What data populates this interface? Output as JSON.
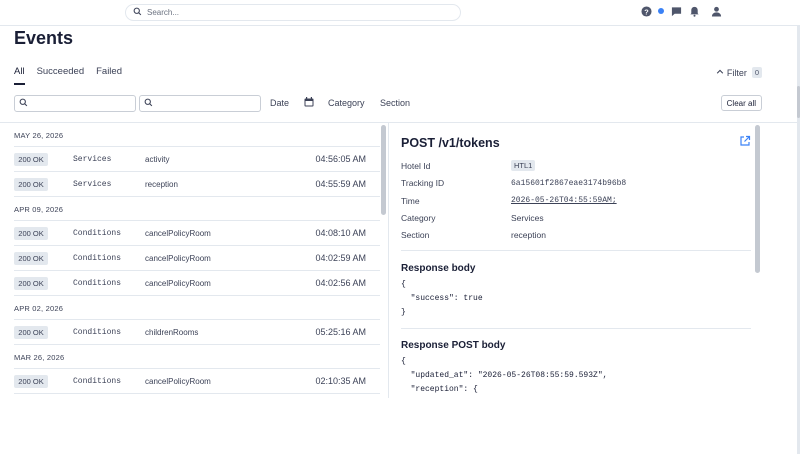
{
  "search": {
    "placeholder": "Search..."
  },
  "page": {
    "title": "Events"
  },
  "tabs": [
    {
      "label": "All",
      "active": true
    },
    {
      "label": "Succeeded",
      "active": false
    },
    {
      "label": "Failed",
      "active": false
    }
  ],
  "filter": {
    "label": "Filter",
    "count": "0"
  },
  "filter_bar": {
    "date_label": "Date",
    "category_label": "Category",
    "section_label": "Section",
    "clear_label": "Clear all"
  },
  "groups": [
    {
      "date": "MAY 26, 2026",
      "rows": [
        {
          "status": "200 OK",
          "category": "Services",
          "section": "activity",
          "time": "04:56:05 AM"
        },
        {
          "status": "200 OK",
          "category": "Services",
          "section": "reception",
          "time": "04:55:59 AM"
        }
      ]
    },
    {
      "date": "APR 09, 2026",
      "rows": [
        {
          "status": "200 OK",
          "category": "Conditions",
          "section": "cancelPolicyRoom",
          "time": "04:08:10 AM"
        },
        {
          "status": "200 OK",
          "category": "Conditions",
          "section": "cancelPolicyRoom",
          "time": "04:02:59 AM"
        },
        {
          "status": "200 OK",
          "category": "Conditions",
          "section": "cancelPolicyRoom",
          "time": "04:02:56 AM"
        }
      ]
    },
    {
      "date": "APR 02, 2026",
      "rows": [
        {
          "status": "200 OK",
          "category": "Conditions",
          "section": "childrenRooms",
          "time": "05:25:16 AM"
        }
      ]
    },
    {
      "date": "MAR 26, 2026",
      "rows": [
        {
          "status": "200 OK",
          "category": "Conditions",
          "section": "cancelPolicyRoom",
          "time": "02:10:35 AM"
        }
      ]
    }
  ],
  "detail": {
    "title": "POST /v1/tokens",
    "fields": {
      "hotel_id_label": "Hotel Id",
      "hotel_id": "HTL1",
      "tracking_label": "Tracking ID",
      "tracking_id": "6a15601f2867eae3174b96b8",
      "time_label": "Time",
      "time": "2026-05-26T04:55:59AM;",
      "category_label": "Category",
      "category": "Services",
      "section_label": "Section",
      "section": "reception"
    },
    "response_body_title": "Response body",
    "response_body": "{\n  \"success\": true\n}",
    "response_post_title": "Response POST body",
    "response_post_body": "{\n  \"updated_at\": \"2026-05-26T08:55:59.593Z\",\n  \"reception\": {"
  }
}
